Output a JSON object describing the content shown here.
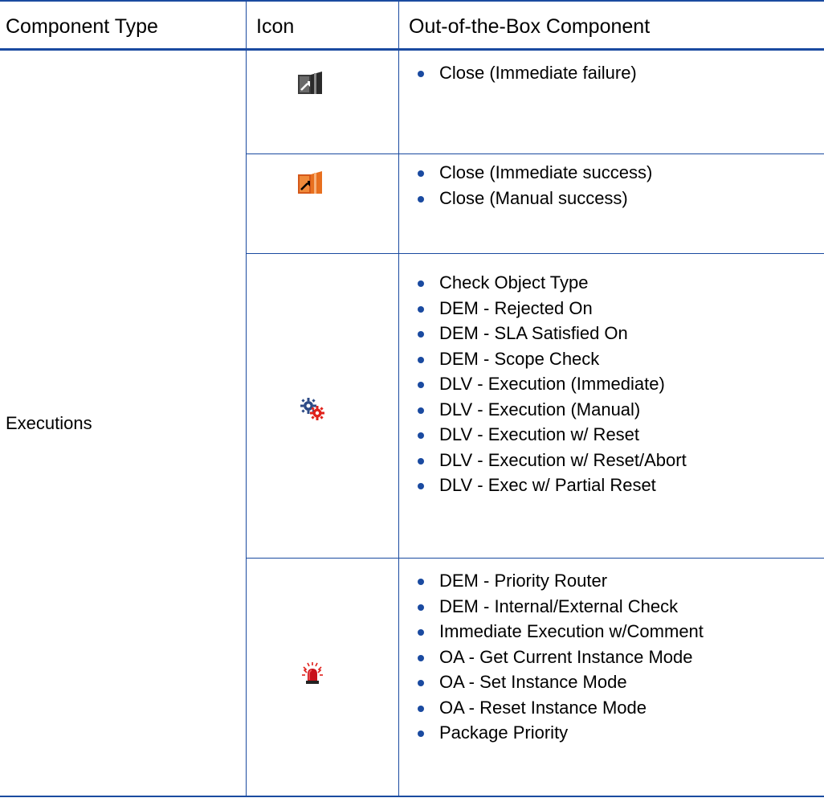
{
  "table": {
    "headers": {
      "component_type": "Component Type",
      "icon": "Icon",
      "component": "Out-of-the-Box Component"
    },
    "component_type_value": "Executions",
    "rows": [
      {
        "icon": "close-failure-door-icon",
        "items": [
          "Close (Immediate failure)"
        ]
      },
      {
        "icon": "close-success-door-icon",
        "items": [
          "Close (Immediate success)",
          "Close (Manual success)"
        ]
      },
      {
        "icon": "gears-icon",
        "items": [
          "Check Object Type",
          "DEM - Rejected On",
          "DEM - SLA Satisfied On",
          "DEM - Scope Check",
          "DLV - Execution (Immediate)",
          "DLV - Execution (Manual)",
          "DLV - Execution w/ Reset",
          "DLV - Execution w/ Reset/Abort",
          "DLV - Exec w/ Partial Reset"
        ]
      },
      {
        "icon": "alarm-siren-icon",
        "items": [
          "DEM - Priority Router",
          "DEM - Internal/External Check",
          "Immediate Execution w/Comment",
          "OA - Get Current Instance Mode",
          "OA - Set Instance Mode",
          "OA - Reset Instance Mode",
          "Package Priority"
        ]
      }
    ]
  },
  "colors": {
    "rule": "#1a4aa0",
    "bullet": "#1a4aa0"
  }
}
